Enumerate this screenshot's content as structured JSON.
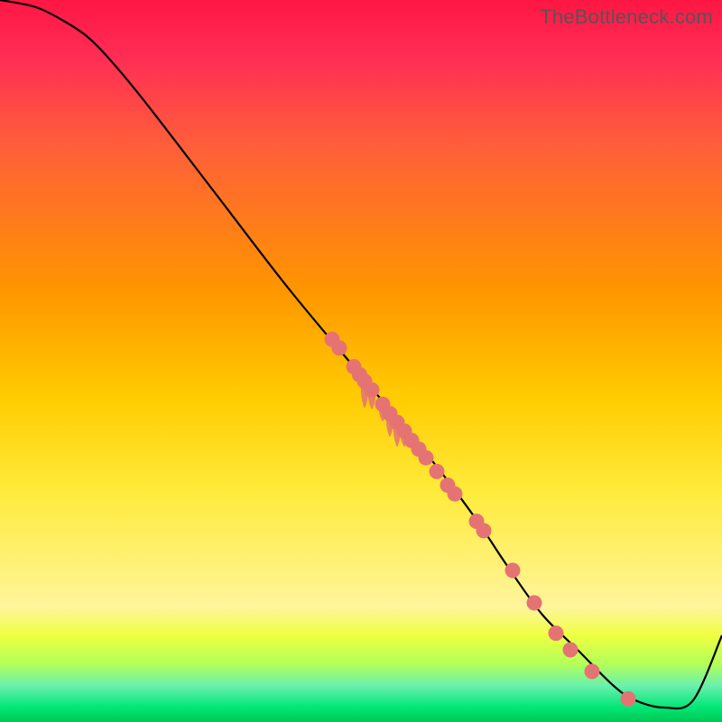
{
  "watermark": "TheBottleneck.com",
  "colors": {
    "gradient_top": "#ff1744",
    "gradient_bottom": "#00c853",
    "line": "#000000",
    "dot": "#e57373"
  },
  "chart_data": {
    "type": "line",
    "title": "",
    "xlabel": "",
    "ylabel": "",
    "xlim": [
      0,
      100
    ],
    "ylim": [
      0,
      100
    ],
    "series": [
      {
        "name": "curve",
        "x": [
          0,
          5,
          9,
          12,
          15,
          20,
          30,
          40,
          50,
          60,
          66,
          70,
          75,
          80,
          85,
          88,
          92,
          96,
          100
        ],
        "y": [
          100,
          99,
          97,
          95,
          92,
          86,
          73,
          60,
          48,
          36,
          28,
          22,
          15,
          10,
          5,
          3,
          2,
          3,
          12
        ]
      }
    ],
    "points": [
      {
        "x": 46.0,
        "y": 53.0
      },
      {
        "x": 47.0,
        "y": 51.8
      },
      {
        "x": 49.0,
        "y": 49.2
      },
      {
        "x": 49.8,
        "y": 48.1
      },
      {
        "x": 50.5,
        "y": 47.2
      },
      {
        "x": 51.5,
        "y": 46.0
      },
      {
        "x": 53.0,
        "y": 44.0
      },
      {
        "x": 54.0,
        "y": 42.7
      },
      {
        "x": 55.0,
        "y": 41.5
      },
      {
        "x": 56.0,
        "y": 40.3
      },
      {
        "x": 57.0,
        "y": 39.0
      },
      {
        "x": 58.0,
        "y": 37.8
      },
      {
        "x": 59.0,
        "y": 36.6
      },
      {
        "x": 60.5,
        "y": 34.7
      },
      {
        "x": 62.0,
        "y": 32.8
      },
      {
        "x": 63.0,
        "y": 31.6
      },
      {
        "x": 66.0,
        "y": 27.8
      },
      {
        "x": 67.0,
        "y": 26.5
      },
      {
        "x": 71.0,
        "y": 21.0
      },
      {
        "x": 74.0,
        "y": 16.5
      },
      {
        "x": 77.0,
        "y": 12.3
      },
      {
        "x": 79.0,
        "y": 10.0
      },
      {
        "x": 82.0,
        "y": 7.0
      },
      {
        "x": 87.0,
        "y": 3.2
      }
    ],
    "drips": [
      {
        "x": 50.5,
        "y": 47.2,
        "len": 3.5
      },
      {
        "x": 51.5,
        "y": 46.0,
        "len": 2.5
      },
      {
        "x": 53.0,
        "y": 44.0,
        "len": 2.2
      },
      {
        "x": 54.0,
        "y": 42.7,
        "len": 3.0
      },
      {
        "x": 55.0,
        "y": 41.5,
        "len": 3.2
      },
      {
        "x": 56.0,
        "y": 40.3,
        "len": 2.0
      }
    ],
    "legend": null,
    "grid": false
  }
}
